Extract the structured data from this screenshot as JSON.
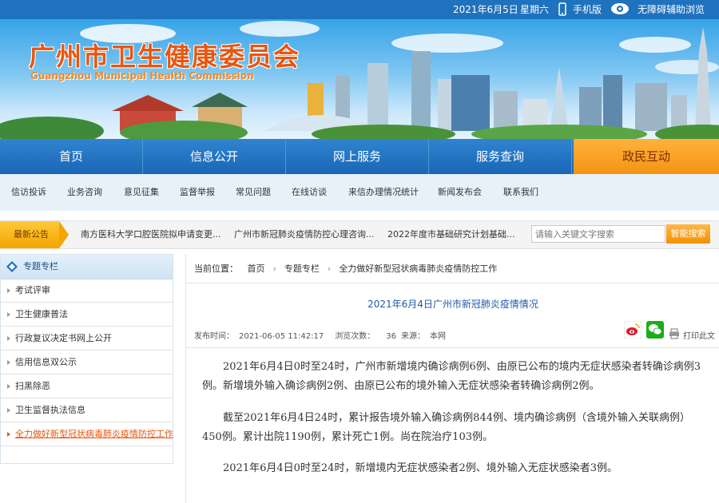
{
  "topbar": {
    "date": "2021年6月5日",
    "weekday": "星期六",
    "mobile_label": "手机版",
    "accessibility_label": "无障碍辅助浏览"
  },
  "banner": {
    "title_cn": "广州市卫生健康委员会",
    "title_en": "Guangzhou Municipal Health Commission"
  },
  "main_nav": [
    "首页",
    "信息公开",
    "网上服务",
    "服务查询",
    "政民互动"
  ],
  "sub_nav": [
    "信访投诉",
    "业务咨询",
    "意见征集",
    "监督举报",
    "常见问题",
    "在线访谈",
    "来信办理情况统计",
    "新闻发布会",
    "联系我们"
  ],
  "notice": {
    "label": "最新公告",
    "items": [
      "南方医科大学口腔医院拟申请变更...",
      "广州市新冠肺炎疫情防控心理咨询...",
      "2022年度市基础研究计划基础..."
    ]
  },
  "search": {
    "placeholder": "请输入关键文字搜索",
    "button": "智能搜索"
  },
  "sidebar": {
    "title": "专题专栏",
    "items": [
      "考试评审",
      "卫生健康普法",
      "行政复议决定书网上公开",
      "信用信息双公示",
      "扫黑除恶",
      "卫生监督执法信息",
      "全力做好新型冠状病毒肺炎疫情防控工作"
    ]
  },
  "breadcrumb": {
    "prefix": "当前位置：",
    "items": [
      "首页",
      "专题专栏",
      "全力做好新型冠状病毒肺炎疫情防控工作"
    ]
  },
  "article": {
    "title": "2021年6月4日广州市新冠肺炎疫情情况",
    "publish_label": "发布时间：",
    "publish_time": "2021-06-05 11:42:17",
    "views_label": "浏览次数：",
    "views": "36",
    "source_label": "来源：",
    "source": "本网",
    "print_label": "打印此文",
    "paragraphs": [
      "2021年6月4日0时至24时，广州市新增境内确诊病例6例、由原已公布的境内无症状感染者转确诊病例3例。新增境外输入确诊病例2例、由原已公布的境外输入无症状感染者转确诊病例2例。",
      "截至2021年6月4日24时，累计报告境外输入确诊病例844例、境内确诊病例（含境外输入关联病例）450例。累计出院1190例，累计死亡1例。尚在院治疗103例。",
      "2021年6月4日0时至24时，新增境内无症状感染者2例、境外输入无症状感染者3例。"
    ]
  },
  "colors": {
    "primary_blue": "#1f72bd",
    "accent_orange": "#f39413",
    "title_orange": "#e8560f",
    "link_blue": "#1f5ba8"
  }
}
